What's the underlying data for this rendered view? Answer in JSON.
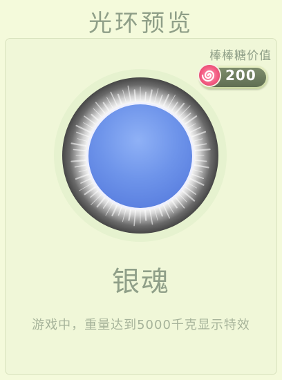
{
  "title": "光环预览",
  "price": {
    "label": "棒棒糖价值",
    "value": "200",
    "icon": "lollipop-candy-icon"
  },
  "halo": {
    "name": "银魂",
    "description": "游戏中，重量达到5000千克显示特效",
    "colors": {
      "orb": "#6e94ea",
      "ring": "#1a1a1a",
      "glow": "#ffffff"
    }
  }
}
